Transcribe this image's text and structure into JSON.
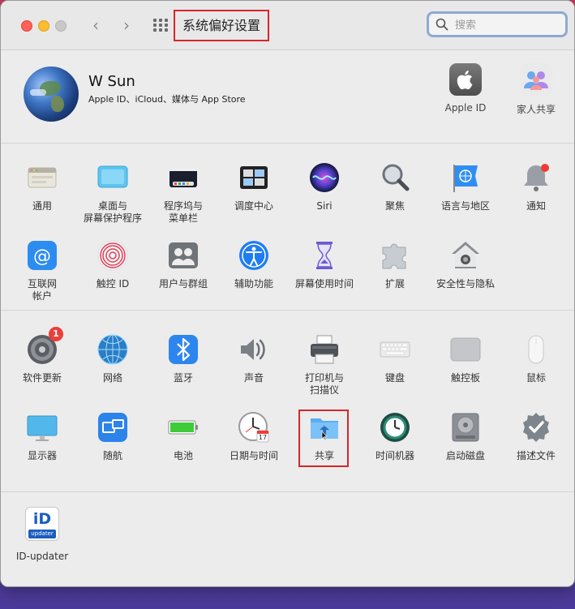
{
  "window": {
    "title": "系统偏好设置",
    "search_placeholder": "搜索"
  },
  "account": {
    "name": "W Sun",
    "subtitle": "Apple ID、iCloud、媒体与 App Store",
    "buttons": [
      {
        "label": "Apple ID",
        "icon": "apple-logo-icon"
      },
      {
        "label": "家人共享",
        "icon": "family-sharing-icon"
      }
    ]
  },
  "section1": [
    {
      "label": "通用",
      "icon": "general-icon"
    },
    {
      "label": "桌面与\n屏幕保护程序",
      "icon": "desktop-screensaver-icon"
    },
    {
      "label": "程序坞与\n菜单栏",
      "icon": "dock-menubar-icon"
    },
    {
      "label": "调度中心",
      "icon": "mission-control-icon"
    },
    {
      "label": "Siri",
      "icon": "siri-icon"
    },
    {
      "label": "聚焦",
      "icon": "spotlight-icon"
    },
    {
      "label": "语言与地区",
      "icon": "language-region-icon"
    },
    {
      "label": "通知",
      "icon": "notifications-icon"
    },
    {
      "label": "互联网\n帐户",
      "icon": "internet-accounts-icon"
    },
    {
      "label": "触控 ID",
      "icon": "touch-id-icon"
    },
    {
      "label": "用户与群组",
      "icon": "users-groups-icon"
    },
    {
      "label": "辅助功能",
      "icon": "accessibility-icon"
    },
    {
      "label": "屏幕使用时间",
      "icon": "screen-time-icon"
    },
    {
      "label": "扩展",
      "icon": "extensions-icon"
    },
    {
      "label": "安全性与隐私",
      "icon": "security-privacy-icon"
    }
  ],
  "section2": [
    {
      "label": "软件更新",
      "icon": "software-update-icon",
      "badge": "1"
    },
    {
      "label": "网络",
      "icon": "network-icon"
    },
    {
      "label": "蓝牙",
      "icon": "bluetooth-icon"
    },
    {
      "label": "声音",
      "icon": "sound-icon"
    },
    {
      "label": "打印机与\n扫描仪",
      "icon": "printers-scanners-icon"
    },
    {
      "label": "键盘",
      "icon": "keyboard-icon"
    },
    {
      "label": "触控板",
      "icon": "trackpad-icon"
    },
    {
      "label": "鼠标",
      "icon": "mouse-icon"
    },
    {
      "label": "显示器",
      "icon": "displays-icon"
    },
    {
      "label": "随航",
      "icon": "sidecar-icon"
    },
    {
      "label": "电池",
      "icon": "battery-icon"
    },
    {
      "label": "日期与时间",
      "icon": "date-time-icon",
      "date_badge": "17"
    },
    {
      "label": "共享",
      "icon": "sharing-icon",
      "highlighted": true
    },
    {
      "label": "时间机器",
      "icon": "time-machine-icon"
    },
    {
      "label": "启动磁盘",
      "icon": "startup-disk-icon"
    },
    {
      "label": "描述文件",
      "icon": "profiles-icon"
    }
  ],
  "section3": [
    {
      "label": "ID-updater",
      "icon": "id-updater-icon",
      "icon_text_top": "iD",
      "icon_text_bottom": "updater"
    }
  ],
  "colors": {
    "highlight": "#d7262c",
    "accent": "#1a7cf5"
  }
}
